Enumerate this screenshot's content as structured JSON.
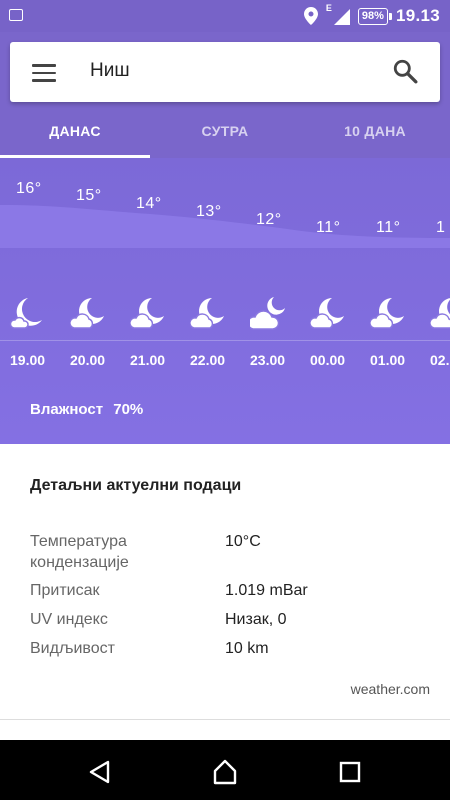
{
  "status_bar": {
    "battery": "98%",
    "time": "19.13",
    "network": "E"
  },
  "search": {
    "city": "Ниш"
  },
  "tabs": [
    {
      "label": "ДАНАС",
      "active": true
    },
    {
      "label": "СУТРА",
      "active": false
    },
    {
      "label": "10 ДАНА",
      "active": false
    }
  ],
  "hourly": [
    {
      "hour": "19.00",
      "temp": "16°",
      "icon": "moon-cloud-icon"
    },
    {
      "hour": "20.00",
      "temp": "15°",
      "icon": "moon-cloud-icon"
    },
    {
      "hour": "21.00",
      "temp": "14°",
      "icon": "moon-cloud-icon"
    },
    {
      "hour": "22.00",
      "temp": "13°",
      "icon": "moon-cloud-icon"
    },
    {
      "hour": "23.00",
      "temp": "12°",
      "icon": "cloud-moon-icon"
    },
    {
      "hour": "00.00",
      "temp": "11°",
      "icon": "moon-cloud-icon"
    },
    {
      "hour": "01.00",
      "temp": "11°",
      "icon": "moon-cloud-icon"
    },
    {
      "hour": "02.",
      "temp": "1",
      "icon": "moon-cloud-icon"
    }
  ],
  "humidity": {
    "label": "Влажност",
    "value": "70%"
  },
  "details": {
    "title": "Детаљни актуелни подаци",
    "rows": [
      {
        "label": "Температура кондензације",
        "value": "10°C"
      },
      {
        "label": "Притисак",
        "value": "1.019 mBar"
      },
      {
        "label": "UV индекс",
        "value": "Низак, 0"
      },
      {
        "label": "Видљивост",
        "value": "10 km"
      }
    ],
    "source": "weather.com"
  },
  "colors": {
    "primary": "#7a66cb",
    "forecast_bg": "#8470e3"
  }
}
